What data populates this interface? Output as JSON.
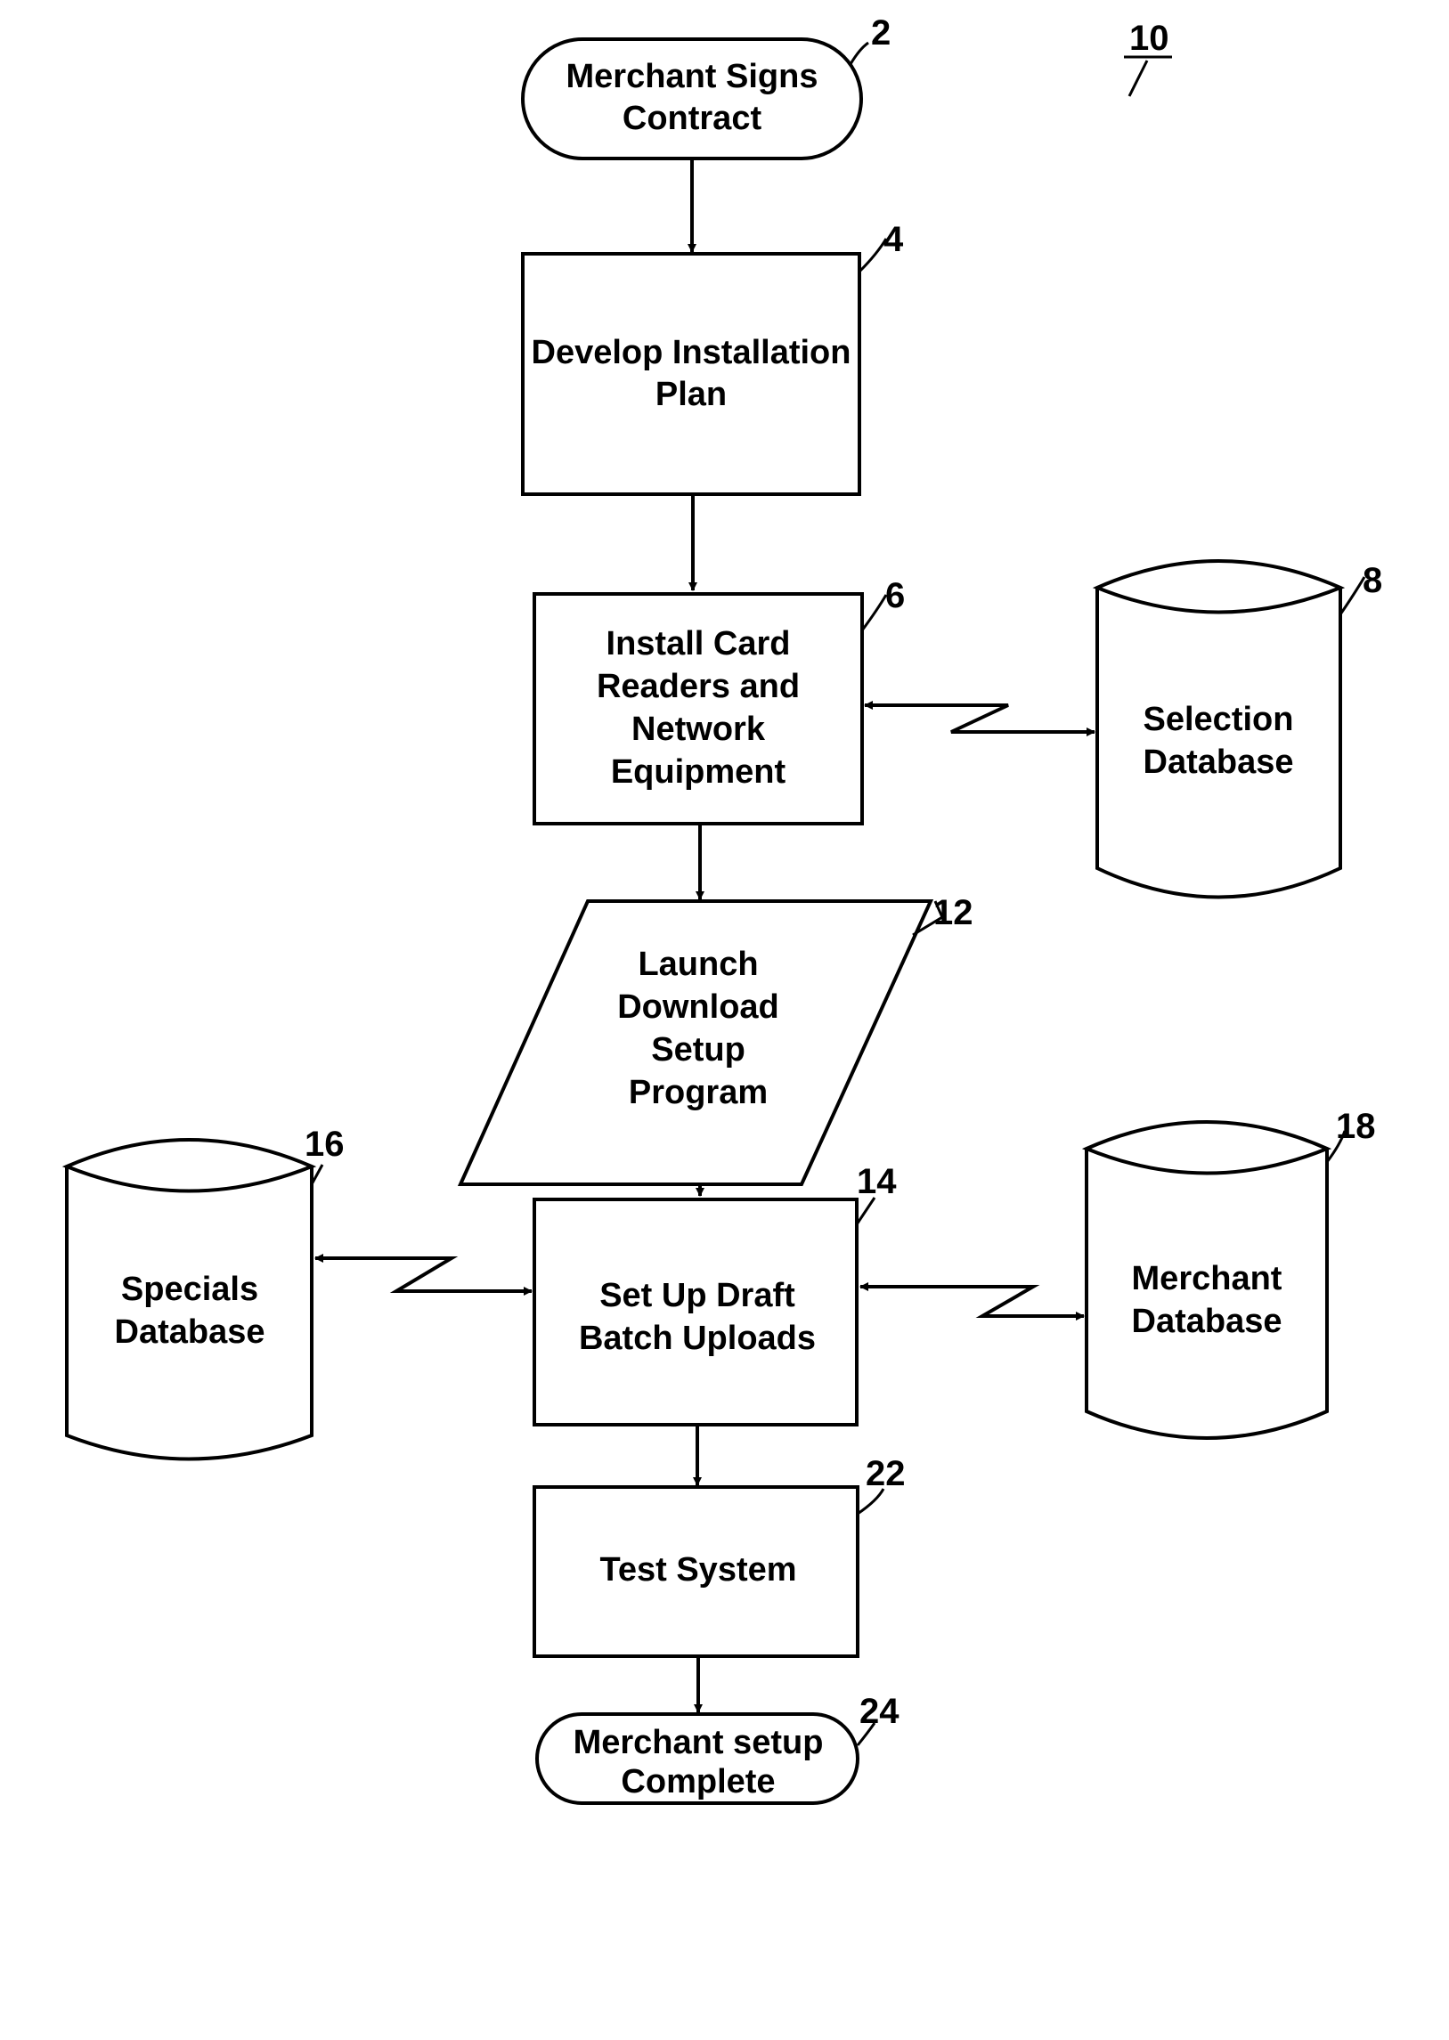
{
  "figure": {
    "reference_number": "10"
  },
  "nodes": {
    "start": {
      "ref": "2",
      "lines": [
        "Merchant Signs",
        "Contract"
      ],
      "type": "terminal"
    },
    "plan": {
      "ref": "4",
      "lines": [
        "Develop Installation",
        "Plan"
      ],
      "type": "process"
    },
    "install": {
      "ref": "6",
      "lines": [
        "Install Card",
        "Readers and",
        "Network",
        "Equipment"
      ],
      "type": "process"
    },
    "selection_db": {
      "ref": "8",
      "lines": [
        "Selection",
        "Database"
      ],
      "type": "database"
    },
    "launch": {
      "ref": "12",
      "lines": [
        "Launch",
        "Download",
        "Setup",
        "Program"
      ],
      "type": "io"
    },
    "setup_batch": {
      "ref": "14",
      "lines": [
        "Set Up Draft",
        "Batch Uploads"
      ],
      "type": "process"
    },
    "specials_db": {
      "ref": "16",
      "lines": [
        "Specials",
        "Database"
      ],
      "type": "database"
    },
    "merchant_db": {
      "ref": "18",
      "lines": [
        "Merchant",
        "Database"
      ],
      "type": "database"
    },
    "test": {
      "ref": "22",
      "lines": [
        "Test System"
      ],
      "type": "process"
    },
    "end": {
      "ref": "24",
      "lines": [
        "Merchant setup",
        "Complete"
      ],
      "type": "terminal"
    }
  },
  "edges": [
    {
      "from": "start",
      "to": "plan",
      "kind": "flow"
    },
    {
      "from": "plan",
      "to": "install",
      "kind": "flow"
    },
    {
      "from": "install",
      "to": "launch",
      "kind": "flow"
    },
    {
      "from": "launch",
      "to": "setup_batch",
      "kind": "flow"
    },
    {
      "from": "setup_batch",
      "to": "test",
      "kind": "flow"
    },
    {
      "from": "test",
      "to": "end",
      "kind": "flow"
    },
    {
      "from": "install",
      "to": "selection_db",
      "kind": "communication-link",
      "bidirectional": true
    },
    {
      "from": "setup_batch",
      "to": "merchant_db",
      "kind": "communication-link",
      "bidirectional": true
    },
    {
      "from": "specials_db",
      "to": "setup_batch",
      "kind": "communication-link",
      "bidirectional": true
    }
  ]
}
